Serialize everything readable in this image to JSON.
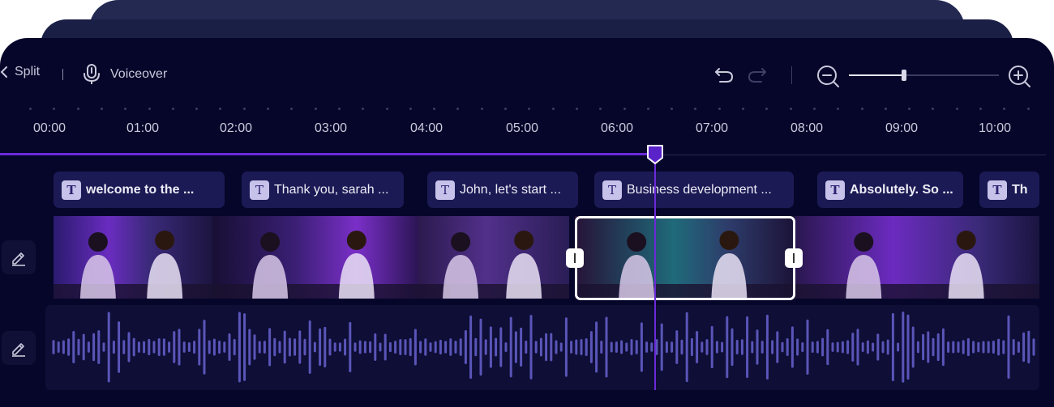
{
  "colors": {
    "panel": "#06062a",
    "accent": "#6b2bd9",
    "caption_bg": "#1c1a55",
    "waveform": "#5a55b8",
    "text": "#c9c9dc"
  },
  "toolbar": {
    "split_label": "Split",
    "voiceover_label": "Voiceover",
    "undo_icon": "undo-icon",
    "redo_icon": "redo-icon",
    "zoom_out_icon": "zoom-out-icon",
    "zoom_in_icon": "zoom-in-icon",
    "zoom_level": 0.37
  },
  "timeline": {
    "ticks": [
      "00:00",
      "01:00",
      "02:00",
      "03:00",
      "04:00",
      "05:00",
      "06:00",
      "07:00",
      "08:00",
      "09:00",
      "10:00"
    ],
    "playhead_time": "06:24",
    "played_fraction": 0.62
  },
  "captions": [
    {
      "text": "welcome to the ...",
      "bold": true
    },
    {
      "text": "Thank you, sarah ...",
      "bold": false
    },
    {
      "text": "John, let's start ...",
      "bold": false
    },
    {
      "text": "Business development ...",
      "bold": false
    },
    {
      "text": "Absolutely. So ...",
      "bold": true
    },
    {
      "text": "Th",
      "bold": true
    }
  ],
  "video_clips": [
    {
      "name": "clip-1"
    },
    {
      "name": "clip-2"
    },
    {
      "name": "clip-3"
    },
    {
      "name": "clip-4-selected"
    },
    {
      "name": "clip-5"
    }
  ],
  "tracks": {
    "caption_edit_icon": "pencil-icon",
    "audio_edit_icon": "pencil-icon"
  }
}
